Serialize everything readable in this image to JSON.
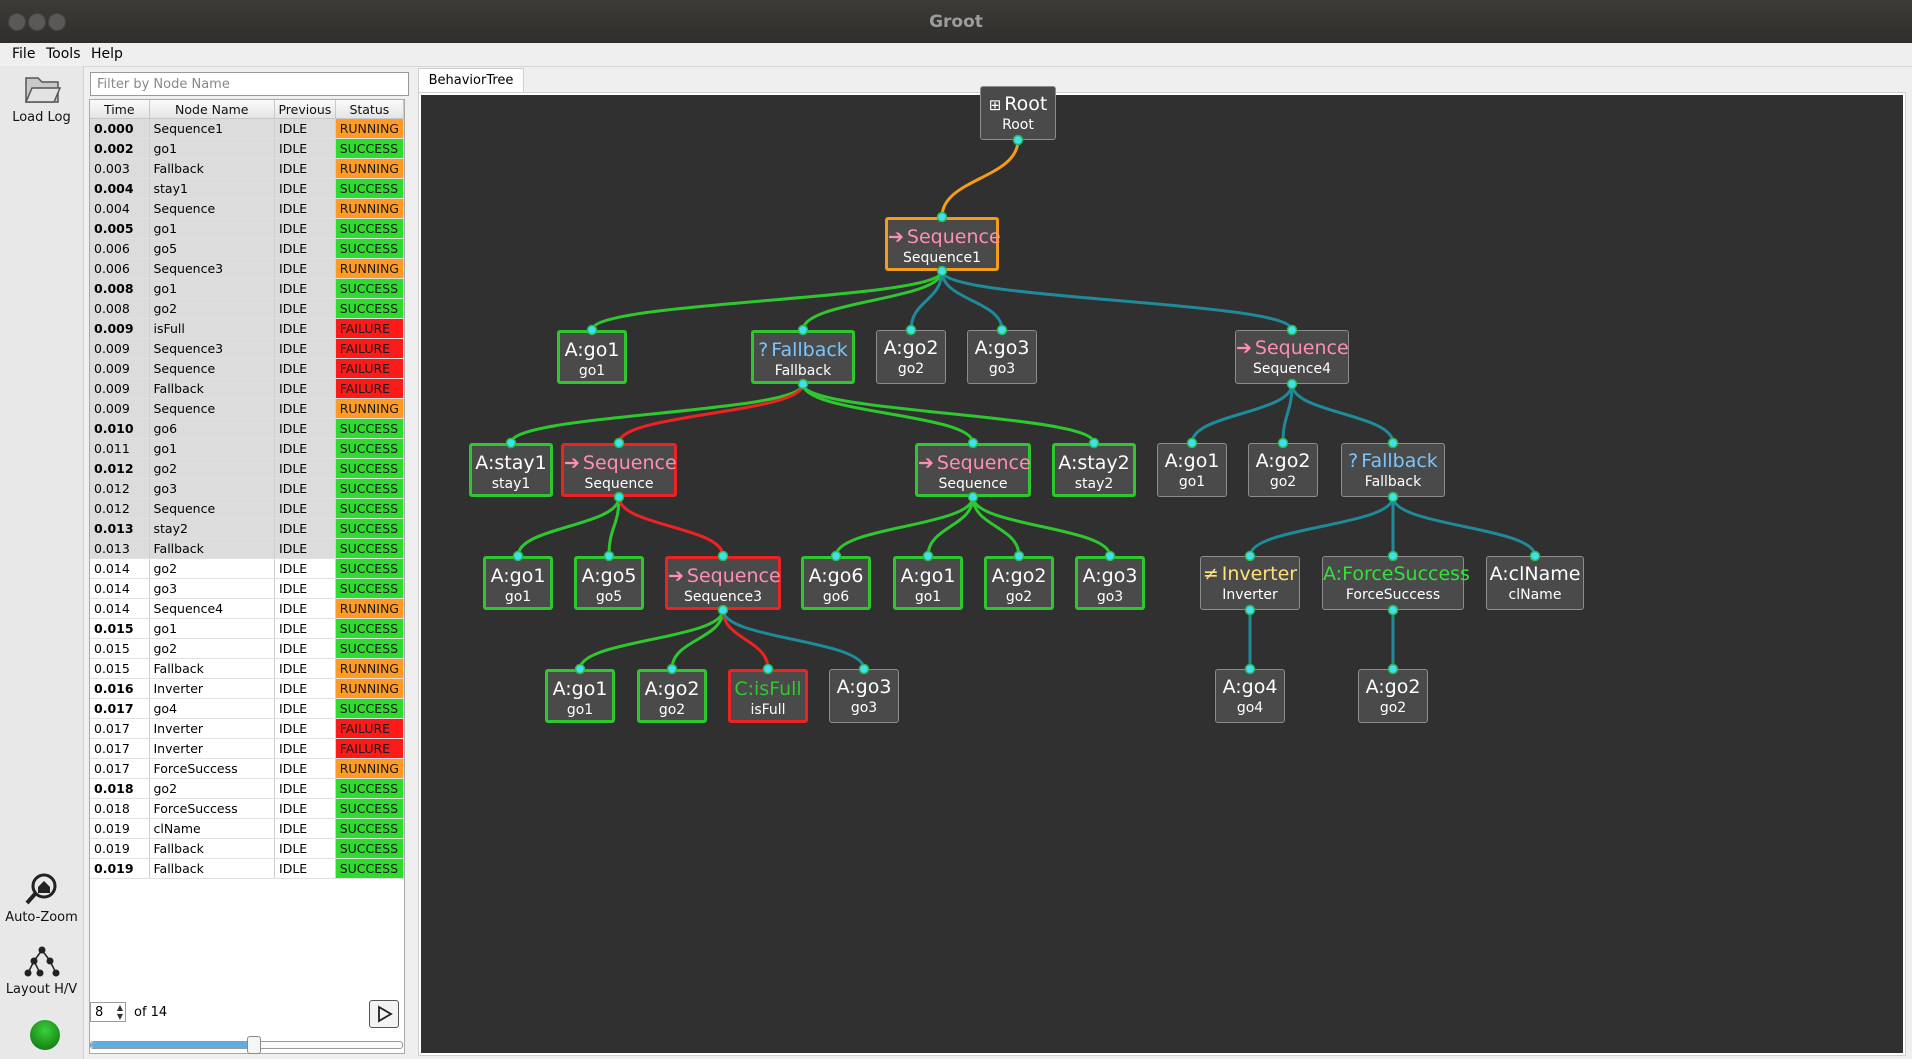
{
  "window": {
    "title": "Groot"
  },
  "menu": [
    "File",
    "Tools",
    "Help"
  ],
  "toolbar": {
    "load_log": "Load Log",
    "auto_zoom": "Auto-Zoom",
    "layout": "Layout H/V"
  },
  "filter": {
    "placeholder": "Filter by Node Name"
  },
  "table": {
    "columns": [
      "Time",
      "Node Name",
      "Previous",
      "Status"
    ],
    "rows": [
      {
        "time": "0.000",
        "name": "Sequence1",
        "prev": "IDLE",
        "status": "RUNNING",
        "bold": true
      },
      {
        "time": "0.002",
        "name": "go1",
        "prev": "IDLE",
        "status": "SUCCESS",
        "bold": true
      },
      {
        "time": "0.003",
        "name": "Fallback",
        "prev": "IDLE",
        "status": "RUNNING",
        "bold": false
      },
      {
        "time": "0.004",
        "name": "stay1",
        "prev": "IDLE",
        "status": "SUCCESS",
        "bold": true
      },
      {
        "time": "0.004",
        "name": "Sequence",
        "prev": "IDLE",
        "status": "RUNNING",
        "bold": false
      },
      {
        "time": "0.005",
        "name": "go1",
        "prev": "IDLE",
        "status": "SUCCESS",
        "bold": true
      },
      {
        "time": "0.006",
        "name": "go5",
        "prev": "IDLE",
        "status": "SUCCESS",
        "bold": false
      },
      {
        "time": "0.006",
        "name": "Sequence3",
        "prev": "IDLE",
        "status": "RUNNING",
        "bold": false
      },
      {
        "time": "0.008",
        "name": "go1",
        "prev": "IDLE",
        "status": "SUCCESS",
        "bold": true
      },
      {
        "time": "0.008",
        "name": "go2",
        "prev": "IDLE",
        "status": "SUCCESS",
        "bold": false
      },
      {
        "time": "0.009",
        "name": "isFull",
        "prev": "IDLE",
        "status": "FAILURE",
        "bold": true
      },
      {
        "time": "0.009",
        "name": "Sequence3",
        "prev": "IDLE",
        "status": "FAILURE",
        "bold": false
      },
      {
        "time": "0.009",
        "name": "Sequence",
        "prev": "IDLE",
        "status": "FAILURE",
        "bold": false
      },
      {
        "time": "0.009",
        "name": "Fallback",
        "prev": "IDLE",
        "status": "FAILURE",
        "bold": false
      },
      {
        "time": "0.009",
        "name": "Sequence",
        "prev": "IDLE",
        "status": "RUNNING",
        "bold": false
      },
      {
        "time": "0.010",
        "name": "go6",
        "prev": "IDLE",
        "status": "SUCCESS",
        "bold": true
      },
      {
        "time": "0.011",
        "name": "go1",
        "prev": "IDLE",
        "status": "SUCCESS",
        "bold": false
      },
      {
        "time": "0.012",
        "name": "go2",
        "prev": "IDLE",
        "status": "SUCCESS",
        "bold": true
      },
      {
        "time": "0.012",
        "name": "go3",
        "prev": "IDLE",
        "status": "SUCCESS",
        "bold": false
      },
      {
        "time": "0.012",
        "name": "Sequence",
        "prev": "IDLE",
        "status": "SUCCESS",
        "bold": false
      },
      {
        "time": "0.013",
        "name": "stay2",
        "prev": "IDLE",
        "status": "SUCCESS",
        "bold": true
      },
      {
        "time": "0.013",
        "name": "Fallback",
        "prev": "IDLE",
        "status": "SUCCESS",
        "bold": false
      },
      {
        "time": "0.014",
        "name": "go2",
        "prev": "IDLE",
        "status": "SUCCESS",
        "bold": false
      },
      {
        "time": "0.014",
        "name": "go3",
        "prev": "IDLE",
        "status": "SUCCESS",
        "bold": false
      },
      {
        "time": "0.014",
        "name": "Sequence4",
        "prev": "IDLE",
        "status": "RUNNING",
        "bold": false
      },
      {
        "time": "0.015",
        "name": "go1",
        "prev": "IDLE",
        "status": "SUCCESS",
        "bold": true
      },
      {
        "time": "0.015",
        "name": "go2",
        "prev": "IDLE",
        "status": "SUCCESS",
        "bold": false
      },
      {
        "time": "0.015",
        "name": "Fallback",
        "prev": "IDLE",
        "status": "RUNNING",
        "bold": false
      },
      {
        "time": "0.016",
        "name": "Inverter",
        "prev": "IDLE",
        "status": "RUNNING",
        "bold": true
      },
      {
        "time": "0.017",
        "name": "go4",
        "prev": "IDLE",
        "status": "SUCCESS",
        "bold": true
      },
      {
        "time": "0.017",
        "name": "Inverter",
        "prev": "IDLE",
        "status": "FAILURE",
        "bold": false
      },
      {
        "time": "0.017",
        "name": "Inverter",
        "prev": "IDLE",
        "status": "FAILURE",
        "bold": false
      },
      {
        "time": "0.017",
        "name": "ForceSuccess",
        "prev": "IDLE",
        "status": "RUNNING",
        "bold": false
      },
      {
        "time": "0.018",
        "name": "go2",
        "prev": "IDLE",
        "status": "SUCCESS",
        "bold": true
      },
      {
        "time": "0.018",
        "name": "ForceSuccess",
        "prev": "IDLE",
        "status": "SUCCESS",
        "bold": false
      },
      {
        "time": "0.019",
        "name": "clName",
        "prev": "IDLE",
        "status": "SUCCESS",
        "bold": false
      },
      {
        "time": "0.019",
        "name": "Fallback",
        "prev": "IDLE",
        "status": "SUCCESS",
        "bold": false
      },
      {
        "time": "0.019",
        "name": "Fallback",
        "prev": "IDLE",
        "status": "SUCCESS",
        "bold": true
      }
    ],
    "shaded_rows": 22
  },
  "pager": {
    "value": "8",
    "of_text": "of 14",
    "position": 0.52
  },
  "tab": {
    "label": "BehaviorTree"
  },
  "colors": {
    "running": "#f59c1a",
    "success": "#2fc72f",
    "failure": "#ee2222",
    "idle_edge": "#1f8a99",
    "port": "#3ee1f2",
    "canvas": "#303030"
  },
  "tree": {
    "nodes": [
      {
        "id": "root",
        "kind": "root",
        "icon": "root-icon",
        "title": "Root",
        "name": "Root",
        "status": "IDLE"
      },
      {
        "id": "seq1",
        "kind": "sequence",
        "icon": "arrow-icon",
        "title": "Sequence",
        "name": "Sequence1",
        "status": "RUNNING"
      },
      {
        "id": "go1a",
        "kind": "action",
        "icon": "",
        "title": "A:go1",
        "name": "go1",
        "status": "SUCCESS"
      },
      {
        "id": "fb1",
        "kind": "fallback",
        "icon": "question-icon",
        "title": "Fallback",
        "name": "Fallback",
        "status": "SUCCESS"
      },
      {
        "id": "go2a",
        "kind": "action",
        "icon": "",
        "title": "A:go2",
        "name": "go2",
        "status": "IDLE"
      },
      {
        "id": "go3a",
        "kind": "action",
        "icon": "",
        "title": "A:go3",
        "name": "go3",
        "status": "IDLE"
      },
      {
        "id": "seq4",
        "kind": "sequence",
        "icon": "arrow-icon",
        "title": "Sequence",
        "name": "Sequence4",
        "status": "IDLE"
      },
      {
        "id": "stay1",
        "kind": "action",
        "icon": "",
        "title": "A:stay1",
        "name": "stay1",
        "status": "SUCCESS"
      },
      {
        "id": "seqA",
        "kind": "sequence",
        "icon": "arrow-icon",
        "title": "Sequence",
        "name": "Sequence",
        "status": "FAILURE"
      },
      {
        "id": "seqB",
        "kind": "sequence",
        "icon": "arrow-icon",
        "title": "Sequence",
        "name": "Sequence",
        "status": "SUCCESS"
      },
      {
        "id": "stay2",
        "kind": "action",
        "icon": "",
        "title": "A:stay2",
        "name": "stay2",
        "status": "SUCCESS"
      },
      {
        "id": "s4go1",
        "kind": "action",
        "icon": "",
        "title": "A:go1",
        "name": "go1",
        "status": "IDLE"
      },
      {
        "id": "s4go2",
        "kind": "action",
        "icon": "",
        "title": "A:go2",
        "name": "go2",
        "status": "IDLE"
      },
      {
        "id": "fb2",
        "kind": "fallback",
        "icon": "question-icon",
        "title": "Fallback",
        "name": "Fallback",
        "status": "IDLE"
      },
      {
        "id": "aGo1",
        "kind": "action",
        "icon": "",
        "title": "A:go1",
        "name": "go1",
        "status": "SUCCESS"
      },
      {
        "id": "aGo5",
        "kind": "action",
        "icon": "",
        "title": "A:go5",
        "name": "go5",
        "status": "SUCCESS"
      },
      {
        "id": "seq3",
        "kind": "sequence",
        "icon": "arrow-icon",
        "title": "Sequence",
        "name": "Sequence3",
        "status": "FAILURE"
      },
      {
        "id": "bGo6",
        "kind": "action",
        "icon": "",
        "title": "A:go6",
        "name": "go6",
        "status": "SUCCESS"
      },
      {
        "id": "bGo1",
        "kind": "action",
        "icon": "",
        "title": "A:go1",
        "name": "go1",
        "status": "SUCCESS"
      },
      {
        "id": "bGo2",
        "kind": "action",
        "icon": "",
        "title": "A:go2",
        "name": "go2",
        "status": "SUCCESS"
      },
      {
        "id": "bGo3",
        "kind": "action",
        "icon": "",
        "title": "A:go3",
        "name": "go3",
        "status": "SUCCESS"
      },
      {
        "id": "inv",
        "kind": "inverter",
        "icon": "not-equal-icon",
        "title": "Inverter",
        "name": "Inverter",
        "status": "IDLE"
      },
      {
        "id": "force",
        "kind": "forcesuccess",
        "icon": "",
        "title": "A:ForceSuccess",
        "name": "ForceSuccess",
        "status": "IDLE"
      },
      {
        "id": "clname",
        "kind": "action",
        "icon": "",
        "title": "A:clName",
        "name": "clName",
        "status": "IDLE"
      },
      {
        "id": "cGo1",
        "kind": "action",
        "icon": "",
        "title": "A:go1",
        "name": "go1",
        "status": "SUCCESS"
      },
      {
        "id": "cGo2",
        "kind": "action",
        "icon": "",
        "title": "A:go2",
        "name": "go2",
        "status": "SUCCESS"
      },
      {
        "id": "isFull",
        "kind": "condition",
        "icon": "",
        "title": "C:isFull",
        "name": "isFull",
        "status": "FAILURE"
      },
      {
        "id": "cGo3",
        "kind": "action",
        "icon": "",
        "title": "A:go3",
        "name": "go3",
        "status": "IDLE"
      },
      {
        "id": "iGo4",
        "kind": "action",
        "icon": "",
        "title": "A:go4",
        "name": "go4",
        "status": "IDLE"
      },
      {
        "id": "fGo2",
        "kind": "action",
        "icon": "",
        "title": "A:go2",
        "name": "go2",
        "status": "IDLE"
      }
    ],
    "edges": [
      {
        "from": "root",
        "to": "seq1",
        "status": "RUNNING"
      },
      {
        "from": "seq1",
        "to": "go1a",
        "status": "SUCCESS"
      },
      {
        "from": "seq1",
        "to": "fb1",
        "status": "SUCCESS"
      },
      {
        "from": "seq1",
        "to": "go2a",
        "status": "IDLE"
      },
      {
        "from": "seq1",
        "to": "go3a",
        "status": "IDLE"
      },
      {
        "from": "seq1",
        "to": "seq4",
        "status": "IDLE"
      },
      {
        "from": "fb1",
        "to": "stay1",
        "status": "SUCCESS"
      },
      {
        "from": "fb1",
        "to": "seqA",
        "status": "FAILURE"
      },
      {
        "from": "fb1",
        "to": "seqB",
        "status": "SUCCESS"
      },
      {
        "from": "fb1",
        "to": "stay2",
        "status": "SUCCESS"
      },
      {
        "from": "seq4",
        "to": "s4go1",
        "status": "IDLE"
      },
      {
        "from": "seq4",
        "to": "s4go2",
        "status": "IDLE"
      },
      {
        "from": "seq4",
        "to": "fb2",
        "status": "IDLE"
      },
      {
        "from": "seqA",
        "to": "aGo1",
        "status": "SUCCESS"
      },
      {
        "from": "seqA",
        "to": "aGo5",
        "status": "SUCCESS"
      },
      {
        "from": "seqA",
        "to": "seq3",
        "status": "FAILURE"
      },
      {
        "from": "seqB",
        "to": "bGo6",
        "status": "SUCCESS"
      },
      {
        "from": "seqB",
        "to": "bGo1",
        "status": "SUCCESS"
      },
      {
        "from": "seqB",
        "to": "bGo2",
        "status": "SUCCESS"
      },
      {
        "from": "seqB",
        "to": "bGo3",
        "status": "SUCCESS"
      },
      {
        "from": "fb2",
        "to": "inv",
        "status": "IDLE"
      },
      {
        "from": "fb2",
        "to": "force",
        "status": "IDLE"
      },
      {
        "from": "fb2",
        "to": "clname",
        "status": "IDLE"
      },
      {
        "from": "seq3",
        "to": "cGo1",
        "status": "SUCCESS"
      },
      {
        "from": "seq3",
        "to": "cGo2",
        "status": "SUCCESS"
      },
      {
        "from": "seq3",
        "to": "isFull",
        "status": "FAILURE"
      },
      {
        "from": "seq3",
        "to": "cGo3",
        "status": "IDLE"
      },
      {
        "from": "inv",
        "to": "iGo4",
        "status": "IDLE"
      },
      {
        "from": "force",
        "to": "fGo2",
        "status": "IDLE"
      }
    ]
  }
}
